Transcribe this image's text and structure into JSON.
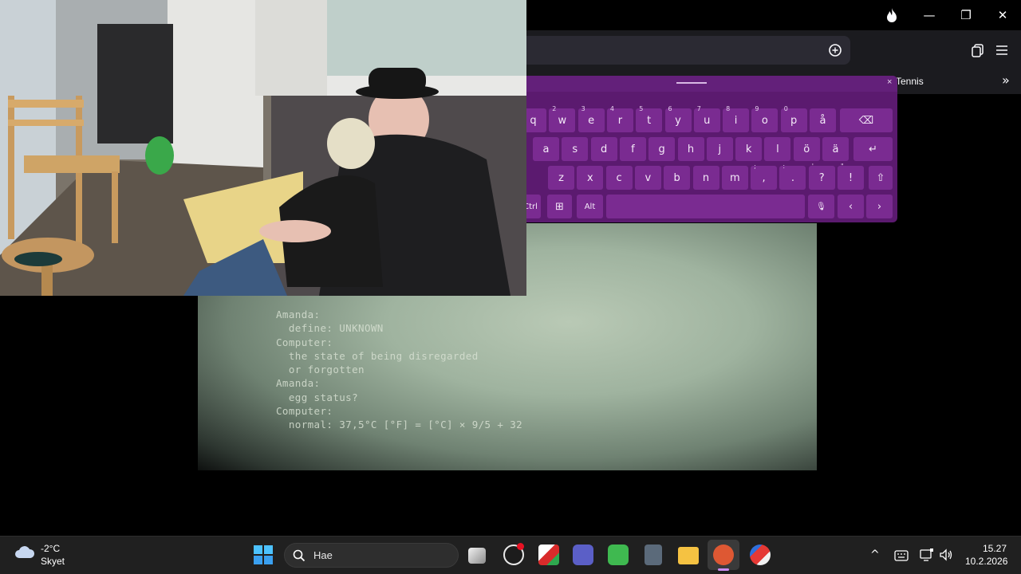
{
  "browser": {
    "bookmark_tennis": "Tennis",
    "window_buttons": {
      "minimize": "—",
      "restore": "❐",
      "close": "✕"
    },
    "overflow_glyph": "»"
  },
  "terminal": {
    "lines": [
      "Amanda:",
      "  define: UNKNOWN",
      "Computer:",
      "  the state of being disregarded",
      "  or forgotten",
      "Amanda:",
      "  egg status?",
      "Computer:",
      "  normal: 37,5°C [°F] = [°C] × 9/5 + 32"
    ]
  },
  "keyboard": {
    "close": "×",
    "row1": [
      {
        "k": "q",
        "s": ""
      },
      {
        "k": "w",
        "s": "2"
      },
      {
        "k": "e",
        "s": "3"
      },
      {
        "k": "r",
        "s": "4"
      },
      {
        "k": "t",
        "s": "5"
      },
      {
        "k": "y",
        "s": "6"
      },
      {
        "k": "u",
        "s": "7"
      },
      {
        "k": "i",
        "s": "8"
      },
      {
        "k": "o",
        "s": "9"
      },
      {
        "k": "p",
        "s": "0"
      },
      {
        "k": "å",
        "s": ""
      }
    ],
    "row2": [
      "a",
      "s",
      "d",
      "f",
      "g",
      "h",
      "j",
      "k",
      "l",
      "ö",
      "ä"
    ],
    "row3": [
      {
        "k": "z",
        "s": ""
      },
      {
        "k": "x",
        "s": ""
      },
      {
        "k": "c",
        "s": ""
      },
      {
        "k": "v",
        "s": ""
      },
      {
        "k": "b",
        "s": ""
      },
      {
        "k": "n",
        "s": ""
      },
      {
        "k": "m",
        "s": ""
      },
      {
        "k": ",",
        "s": ";"
      },
      {
        "k": ".",
        "s": ":"
      },
      {
        "k": "?",
        "s": "'"
      },
      {
        "k": "!",
        "s": "\""
      }
    ],
    "backspace": "⌫",
    "enter": "↵",
    "shift": "⇧",
    "ctrl": "Ctrl",
    "win": "⊞",
    "alt": "Alt",
    "mic": "🎙",
    "left": "‹",
    "right": "›"
  },
  "taskbar": {
    "weather_temp": "-2°C",
    "weather_cond": "Skyet",
    "search_placeholder": "Hae",
    "time": "15.27",
    "date": "10.2.2026",
    "tray_chevron": "^"
  },
  "colors": {
    "keyboard_bg": "#5b1a6f",
    "key_bg": "#7a2b91",
    "taskbar_bg": "#202020",
    "browser_bg": "#1b1b1f"
  }
}
